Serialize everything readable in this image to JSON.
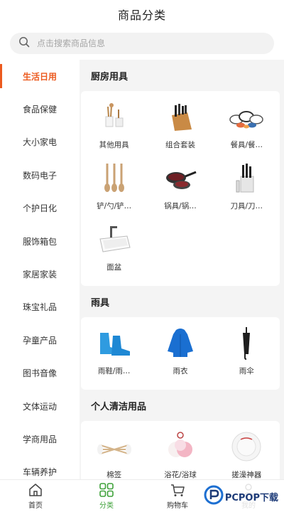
{
  "header": {
    "title": "商品分类"
  },
  "search": {
    "placeholder": "点击搜索商品信息"
  },
  "sidebar": {
    "items": [
      {
        "label": "生活日用",
        "active": true
      },
      {
        "label": "食品保健"
      },
      {
        "label": "大小家电"
      },
      {
        "label": "数码电子"
      },
      {
        "label": "个护日化"
      },
      {
        "label": "服饰箱包"
      },
      {
        "label": "家居家装"
      },
      {
        "label": "珠宝礼品"
      },
      {
        "label": "孕童产品"
      },
      {
        "label": "图书音像"
      },
      {
        "label": "文体运动"
      },
      {
        "label": "学商用品"
      },
      {
        "label": "车辆养护"
      }
    ]
  },
  "sections": [
    {
      "title": "厨房用具",
      "items": [
        {
          "label": "其他用具",
          "icon": "utensil-holder-icon"
        },
        {
          "label": "组合套装",
          "icon": "knife-block-icon"
        },
        {
          "label": "餐具/餐…",
          "icon": "tableware-set-icon"
        },
        {
          "label": "铲/勺/铲…",
          "icon": "wooden-spoons-icon"
        },
        {
          "label": "锅具/锅…",
          "icon": "cookware-pans-icon"
        },
        {
          "label": "刀具/刀…",
          "icon": "knife-set-icon"
        },
        {
          "label": "面盆",
          "icon": "basin-sink-icon"
        }
      ]
    },
    {
      "title": "雨具",
      "items": [
        {
          "label": "雨鞋/雨…",
          "icon": "rain-shoe-cover-icon"
        },
        {
          "label": "雨衣",
          "icon": "raincoat-icon"
        },
        {
          "label": "雨伞",
          "icon": "umbrella-icon"
        }
      ]
    },
    {
      "title": "个人清洁用品",
      "items": [
        {
          "label": "棉签",
          "icon": "cotton-swab-icon"
        },
        {
          "label": "浴花/浴球",
          "icon": "bath-pouf-icon"
        },
        {
          "label": "搓澡神器",
          "icon": "bath-scrubber-icon"
        }
      ]
    }
  ],
  "tabbar": {
    "tabs": [
      {
        "label": "首页",
        "icon": "home-icon"
      },
      {
        "label": "分类",
        "icon": "category-grid-icon",
        "active": true
      },
      {
        "label": "购物车",
        "icon": "cart-icon"
      },
      {
        "label": "我的",
        "icon": "user-icon"
      }
    ]
  },
  "watermark": {
    "text": "PCPOP下载"
  },
  "colors": {
    "accent": "#ec5a1f",
    "tab_active": "#3fa23a",
    "content_bg": "#f4f4f4"
  }
}
